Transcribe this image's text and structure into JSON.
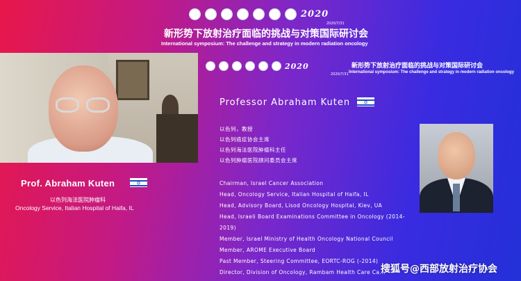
{
  "header": {
    "logo_text": "2020",
    "date": "2020/7/31",
    "title_cn": "新形势下放射治疗面临的挑战与对策国际研讨会",
    "title_en": "International symposium: The challenge and strategy  in modern radiation oncology"
  },
  "slide": {
    "header": {
      "logo_text": "2020",
      "date": "2020/7/31",
      "title_cn": "新形势下放射治疗面临的挑战与对策国际研讨会",
      "title_en": "International symposium: The challenge and strategy  in modern radiation oncology"
    },
    "speaker_name": "Professor Abraham Kuten",
    "flag_icon": "israel-flag-icon",
    "cn_lines": [
      "以色列，教授",
      "以色列癌症协会主席",
      "以色列海法医院肿瘤科主任",
      "以色列肿瘤医院顾问委员会主席"
    ],
    "en_lines": [
      "Chairman, Israel Cancer Association",
      "Head, Oncology Service, Italian Hospital of Haifa, IL",
      "Head, Advisory Board, Lisod Oncology Hospital, Kiev, UA",
      "Head, Israeli Board Examinations Committee in Oncology (2014-",
      "2019)",
      "Member, Israel Ministry of Health Oncology National Council",
      "Member, AROME Executive Board",
      "Past Member, Steering Committee, EORTC-ROG (-2014)",
      "Director, Division of Oncology, Rambam Health Care Ca..."
    ]
  },
  "video_panel": {
    "name": "Prof. Abraham Kuten",
    "cn_affiliation": "以色列海法医院肿瘤科",
    "en_affiliation": "Oncology Service, Italian Hospital of Haifa, IL"
  },
  "watermark": "搜狐号@西部放射治疗协会",
  "colors": {
    "bg_left": "#e8174a",
    "bg_mid": "#7d27c9",
    "bg_right": "#2330d8",
    "flag_blue": "#1a48c8"
  }
}
